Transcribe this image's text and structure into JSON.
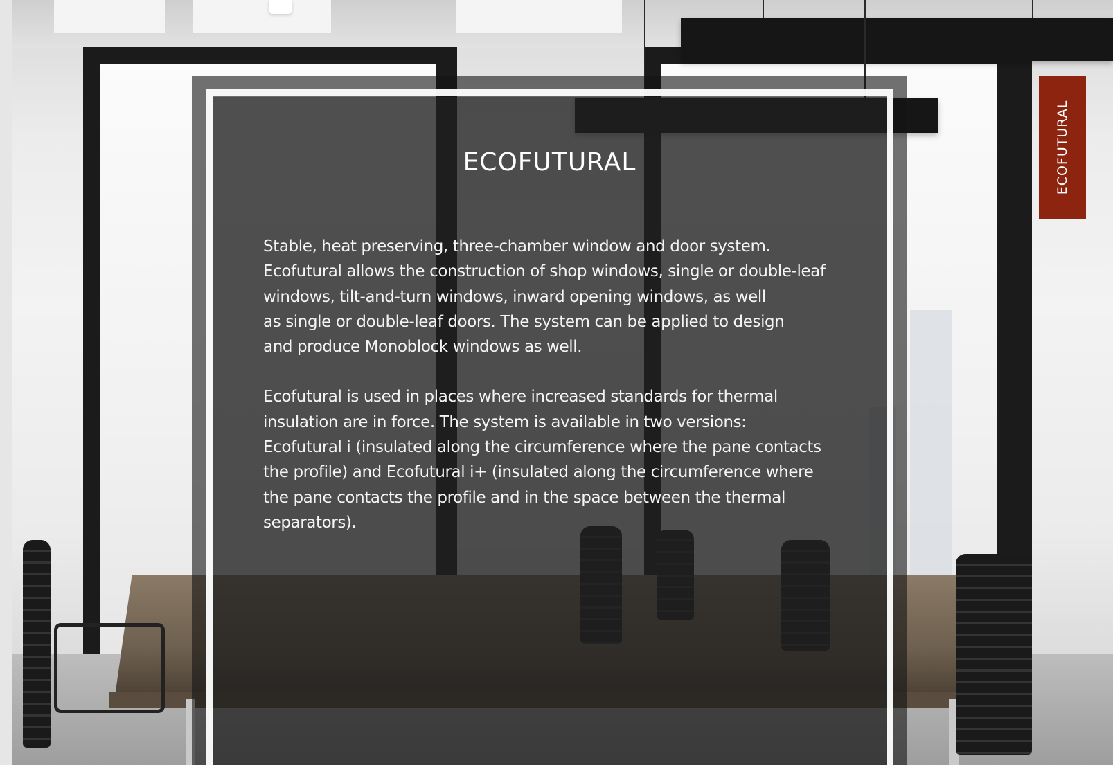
{
  "side_tab": {
    "label": "ECOFUTURAL",
    "color": "#8c2410"
  },
  "content": {
    "title": "ECOFUTURAL",
    "paragraph1_lines": [
      "Stable, heat preserving, three-chamber window and door system.",
      "Ecofutural allows the construction of shop windows, single or double-leaf",
      "windows, tilt-and-turn windows, inward opening windows, as well",
      "as single or double-leaf doors. The system can be applied to design",
      "and produce Monoblock windows as well."
    ],
    "paragraph2_lines": [
      "Ecofutural is used in places where increased standards for thermal",
      "insulation are in force. The system is available in two versions:",
      "Ecofutural i (insulated along the circumference where the pane contacts",
      "the profile) and Ecofutural i+ (insulated along the circumference where",
      "the pane contacts the profile and in the space between the thermal",
      "separators)."
    ]
  }
}
